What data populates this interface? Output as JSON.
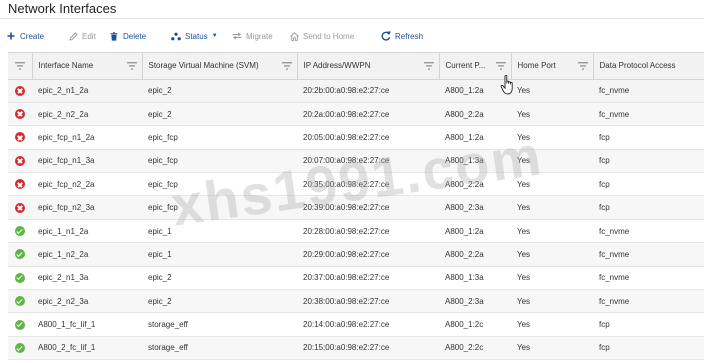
{
  "page": {
    "title": "Network Interfaces"
  },
  "toolbar": {
    "create": "Create",
    "edit": "Edit",
    "delete": "Delete",
    "status": "Status",
    "migrate": "Migrate",
    "send_to_home": "Send to Home",
    "refresh": "Refresh"
  },
  "table": {
    "headers": {
      "interface_name": "Interface Name",
      "svm": "Storage Virtual Machine (SVM)",
      "ip": "IP Address/WWPN",
      "current_port": "Current P...",
      "home_port": "Home Port",
      "protocol": "Data Protocol Access"
    },
    "rows": [
      {
        "status": "error",
        "name": "epic_2_n1_2a",
        "svm": "epic_2",
        "ip": "20:2b:00:a0:98:e2:27:ce",
        "current_port": "A800_1:2a",
        "home_port": "Yes",
        "protocol": "fc_nvme"
      },
      {
        "status": "error",
        "name": "epic_2_n2_2a",
        "svm": "epic_2",
        "ip": "20:2a:00:a0:98:e2:27:ce",
        "current_port": "A800_2:2a",
        "home_port": "Yes",
        "protocol": "fc_nvme"
      },
      {
        "status": "error",
        "name": "epic_fcp_n1_2a",
        "svm": "epic_fcp",
        "ip": "20:05:00:a0:98:e2:27:ce",
        "current_port": "A800_1:2a",
        "home_port": "Yes",
        "protocol": "fcp"
      },
      {
        "status": "error",
        "name": "epic_fcp_n1_3a",
        "svm": "epic_fcp",
        "ip": "20:07:00:a0:98:e2:27:ce",
        "current_port": "A800_1:3a",
        "home_port": "Yes",
        "protocol": "fcp"
      },
      {
        "status": "error",
        "name": "epic_fcp_n2_2a",
        "svm": "epic_fcp",
        "ip": "20:35:00:a0:98:e2:27:ce",
        "current_port": "A800_2:2a",
        "home_port": "Yes",
        "protocol": "fcp"
      },
      {
        "status": "error",
        "name": "epic_fcp_n2_3a",
        "svm": "epic_fcp",
        "ip": "20:39:00:a0:98:e2:27:ce",
        "current_port": "A800_2:3a",
        "home_port": "Yes",
        "protocol": "fcp"
      },
      {
        "status": "ok",
        "name": "epic_1_n1_2a",
        "svm": "epic_1",
        "ip": "20:28:00:a0:98:e2:27:ce",
        "current_port": "A800_1:2a",
        "home_port": "Yes",
        "protocol": "fc_nvme"
      },
      {
        "status": "ok",
        "name": "epic_1_n2_2a",
        "svm": "epic_1",
        "ip": "20:29:00:a0:98:e2:27:ce",
        "current_port": "A800_2:2a",
        "home_port": "Yes",
        "protocol": "fc_nvme"
      },
      {
        "status": "ok",
        "name": "epic_2_n1_3a",
        "svm": "epic_2",
        "ip": "20:37:00:a0:98:e2:27:ce",
        "current_port": "A800_1:3a",
        "home_port": "Yes",
        "protocol": "fc_nvme"
      },
      {
        "status": "ok",
        "name": "epic_2_n2_3a",
        "svm": "epic_2",
        "ip": "20:38:00:a0:98:e2:27:ce",
        "current_port": "A800_2:3a",
        "home_port": "Yes",
        "protocol": "fc_nvme"
      },
      {
        "status": "ok",
        "name": "A800_1_fc_lif_1",
        "svm": "storage_eff",
        "ip": "20:14:00:a0:98:e2:27:ce",
        "current_port": "A800_1:2c",
        "home_port": "Yes",
        "protocol": "fcp"
      },
      {
        "status": "ok",
        "name": "A800_2_fc_lif_1",
        "svm": "storage_eff",
        "ip": "20:15:00:a0:98:e2:27:ce",
        "current_port": "A800_2:2c",
        "home_port": "Yes",
        "protocol": "fcp"
      }
    ]
  },
  "watermark": {
    "text": "xhs1991.com"
  },
  "icons": {
    "create": "plus-icon",
    "edit": "pencil-icon",
    "delete": "trash-icon",
    "status": "status-icon",
    "migrate": "migrate-icon",
    "send_to_home": "home-icon",
    "refresh": "refresh-icon",
    "filter": "funnel-icon",
    "status_error": "error-status-icon",
    "status_ok": "ok-status-icon"
  },
  "colors": {
    "toolbar_active": "#1f4f9a",
    "toolbar_disabled": "#9a9a9a",
    "status_error": "#d62a2f",
    "status_ok": "#5fb548",
    "header_bg": "#f2f2f2"
  }
}
